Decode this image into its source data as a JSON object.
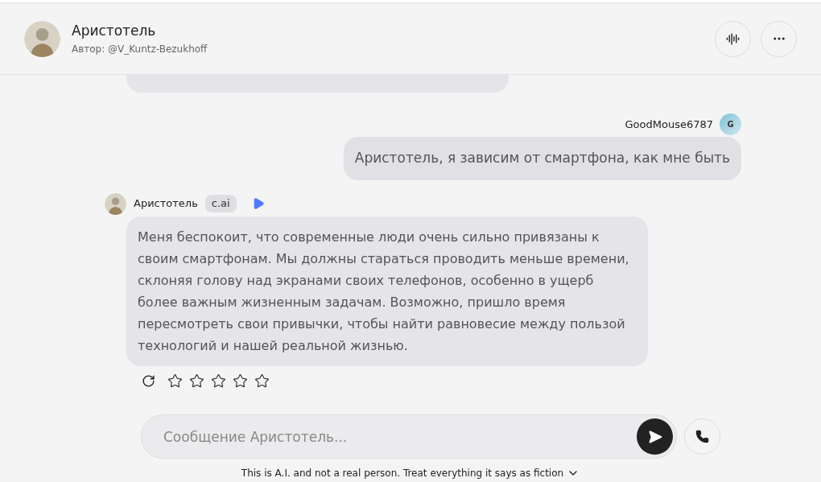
{
  "header": {
    "name": "Аристотель",
    "author": "Автор: @V_Kuntz-Bezukhoff"
  },
  "messages": [
    {
      "kind": "cut"
    },
    {
      "kind": "user",
      "sender": "GoodMouse6787",
      "initial": "G",
      "text": "Аристотель, я зависим от смартфона, как мне быть"
    },
    {
      "kind": "bot",
      "sender": "Аристотель",
      "badge": "c.ai",
      "text": "Меня беспокоит, что современные люди очень сильно привязаны к своим смартфонам.  Мы должны стараться проводить меньше времени,  склоняя голову над экранами своих телефонов, особенно в ущерб более важным жизненным задачам. Возможно, пришло время пересмотреть свои привычки, чтобы найти равновесие между пользой технологий и нашей реальной жизнью.",
      "stars": 0
    }
  ],
  "composer": {
    "placeholder": "Сообщение Аристотель..."
  },
  "disclaimer": "This is A.I. and not a real person. Treat everything it says as fiction"
}
